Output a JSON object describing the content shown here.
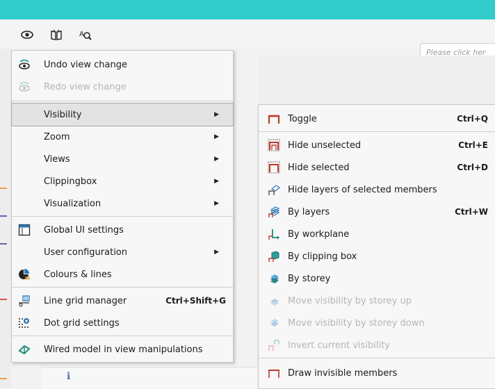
{
  "toolbar": {
    "search_placeholder": "Please click her"
  },
  "main_menu": {
    "undo_view_change": "Undo view change",
    "redo_view_change": "Redo view change",
    "visibility": "Visibility",
    "zoom": "Zoom",
    "views": "Views",
    "clippingbox": "Clippingbox",
    "visualization": "Visualization",
    "global_ui_settings": "Global UI settings",
    "user_configuration": "User configuration",
    "colours_lines": "Colours & lines",
    "line_grid_manager": "Line grid manager",
    "line_grid_manager_shortcut": "Ctrl+Shift+G",
    "dot_grid_settings": "Dot grid settings",
    "wired_model": "Wired model in view manipulations"
  },
  "visibility_menu": {
    "toggle": "Toggle",
    "toggle_shortcut": "Ctrl+Q",
    "hide_unselected": "Hide unselected",
    "hide_unselected_shortcut": "Ctrl+E",
    "hide_selected": "Hide selected",
    "hide_selected_shortcut": "Ctrl+D",
    "hide_layers_selected": "Hide layers of selected members",
    "by_layers": "By layers",
    "by_layers_shortcut": "Ctrl+W",
    "by_workplane": "By workplane",
    "by_clipping_box": "By clipping box",
    "by_storey": "By storey",
    "move_storey_up": "Move visibility by storey up",
    "move_storey_down": "Move visibility by storey down",
    "invert_visibility": "Invert current visibility",
    "draw_invisible": "Draw invisible members"
  },
  "colors": {
    "accent": "#33cccc",
    "icon_red": "#c0392b",
    "icon_blue": "#2e75b6",
    "disabled_text": "#b5b5b5"
  }
}
